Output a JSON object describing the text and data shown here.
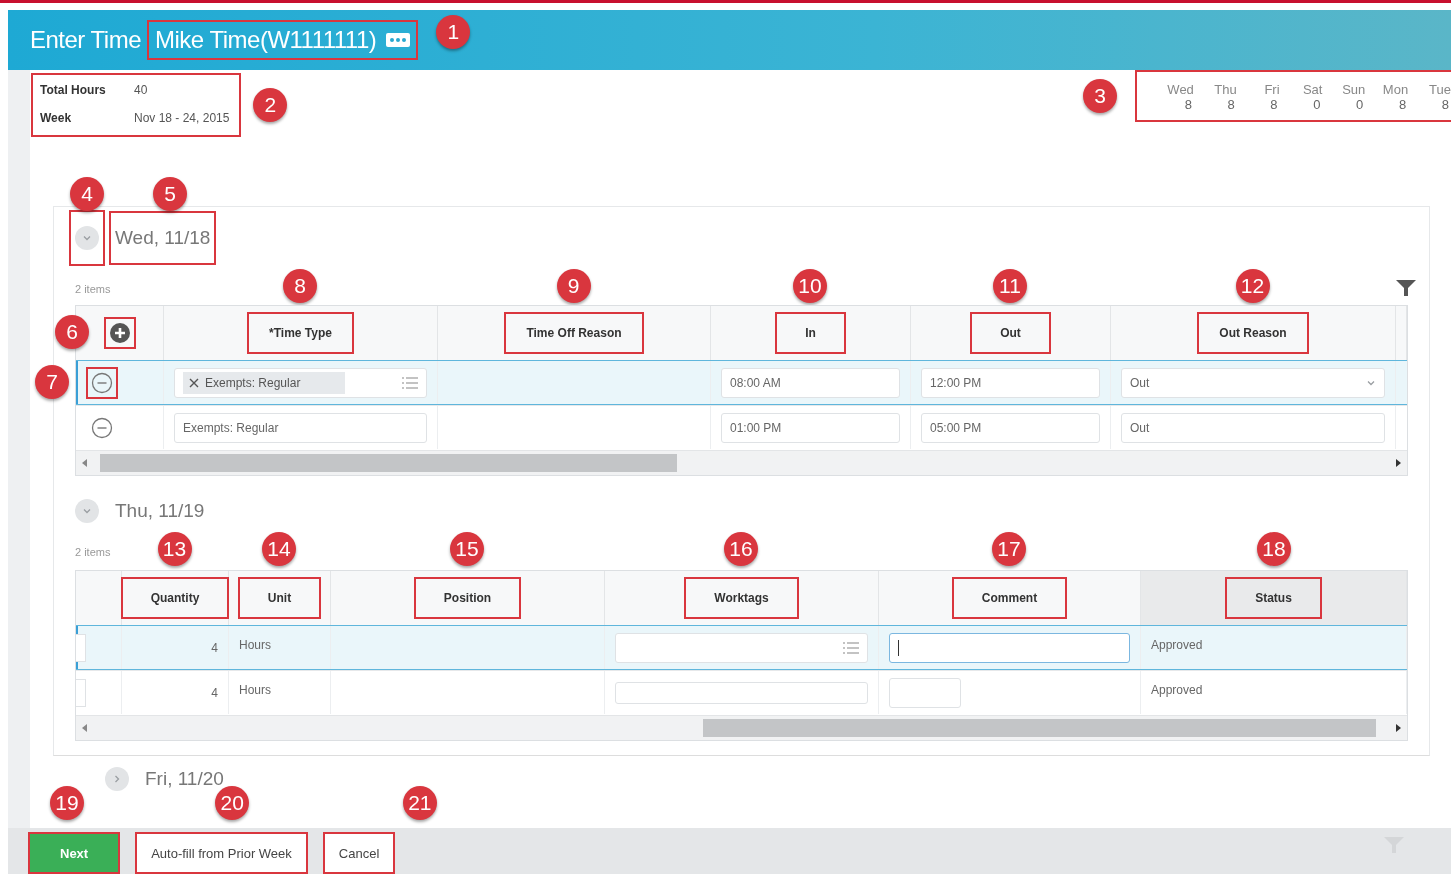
{
  "header": {
    "title": "Enter Time",
    "worker": "Mike Time(W1111111)",
    "marked": true,
    "callout": "1"
  },
  "summary": {
    "marked": true,
    "callout": "2",
    "rows": [
      {
        "label": "Total Hours",
        "value": "40"
      },
      {
        "label": "Week",
        "value": "Nov 18 - 24, 2015"
      }
    ]
  },
  "day_totals": {
    "marked": true,
    "callout": "3",
    "days": [
      {
        "day": "Wed",
        "hours": "8"
      },
      {
        "day": "Thu",
        "hours": "8"
      },
      {
        "day": "Fri",
        "hours": "8"
      },
      {
        "day": "Sat",
        "hours": "0"
      },
      {
        "day": "Sun",
        "hours": "0"
      },
      {
        "day": "Mon",
        "hours": "8"
      },
      {
        "day": "Tue",
        "hours": "8"
      }
    ]
  },
  "days": [
    {
      "label": "Wed, 11/18",
      "expanded": true,
      "toggle_marked": true,
      "toggle_callout": "4",
      "label_marked": true,
      "label_callout": "5",
      "count": "2 items",
      "table": {
        "scrolled_right": false,
        "filter": true,
        "columns": [
          {
            "kind": "add",
            "marked": true,
            "callout": "6"
          },
          {
            "label": "*Time Type",
            "marked": true,
            "callout": "8"
          },
          {
            "label": "Time Off Reason",
            "marked": true,
            "callout": "9"
          },
          {
            "label": "In",
            "marked": true,
            "callout": "10"
          },
          {
            "label": "Out",
            "marked": true,
            "callout": "11"
          },
          {
            "label": "Out Reason",
            "marked": true,
            "callout": "12"
          }
        ],
        "rows": [
          {
            "selected": true,
            "cells": [
              {
                "kind": "remove",
                "marked": true,
                "callout": "7"
              },
              {
                "kind": "chip",
                "value": "Exempts: Regular"
              },
              {
                "kind": "empty"
              },
              {
                "kind": "input",
                "value": "08:00 AM"
              },
              {
                "kind": "input",
                "value": "12:00 PM"
              },
              {
                "kind": "select",
                "value": "Out"
              }
            ]
          },
          {
            "selected": false,
            "cells": [
              {
                "kind": "remove",
                "marked": false
              },
              {
                "kind": "input",
                "value": "Exempts: Regular"
              },
              {
                "kind": "empty"
              },
              {
                "kind": "input",
                "value": "01:00 PM"
              },
              {
                "kind": "input",
                "value": "05:00 PM"
              },
              {
                "kind": "input",
                "value": "Out"
              }
            ]
          }
        ]
      }
    },
    {
      "label": "Thu, 11/19",
      "expanded": true,
      "toggle_marked": false,
      "label_marked": false,
      "count": "2 items",
      "table": {
        "scrolled_right": true,
        "filter": false,
        "columns": [
          {
            "kind": "blank"
          },
          {
            "label": "Quantity",
            "marked": true,
            "callout": "13"
          },
          {
            "label": "Unit",
            "marked": true,
            "callout": "14"
          },
          {
            "label": "Position",
            "marked": true,
            "callout": "15"
          },
          {
            "label": "Worktags",
            "marked": true,
            "callout": "16"
          },
          {
            "label": "Comment",
            "marked": true,
            "callout": "17"
          },
          {
            "label": "Status",
            "marked": true,
            "callout": "18",
            "sorted": true
          }
        ],
        "rows": [
          {
            "selected": true,
            "cells": [
              {
                "kind": "stub"
              },
              {
                "kind": "number",
                "value": "4"
              },
              {
                "kind": "text",
                "value": "Hours"
              },
              {
                "kind": "empty"
              },
              {
                "kind": "prompt"
              },
              {
                "kind": "input",
                "focused": true
              },
              {
                "kind": "text",
                "value": "Approved"
              }
            ]
          },
          {
            "selected": false,
            "cells": [
              {
                "kind": "stub"
              },
              {
                "kind": "number",
                "value": "4"
              },
              {
                "kind": "text",
                "value": "Hours"
              },
              {
                "kind": "empty"
              },
              {
                "kind": "box"
              },
              {
                "kind": "short_box"
              },
              {
                "kind": "text",
                "value": "Approved"
              }
            ]
          }
        ]
      }
    },
    {
      "label": "Fri, 11/20",
      "expanded": false,
      "toggle_marked": false,
      "label_marked": false
    }
  ],
  "footer": {
    "buttons": [
      {
        "label": "Next",
        "kind": "primary",
        "marked": true,
        "callout": "19"
      },
      {
        "label": "Auto-fill from Prior Week",
        "kind": "secondary",
        "marked": true,
        "callout": "20"
      },
      {
        "label": "Cancel",
        "kind": "secondary",
        "marked": true,
        "callout": "21"
      }
    ]
  }
}
